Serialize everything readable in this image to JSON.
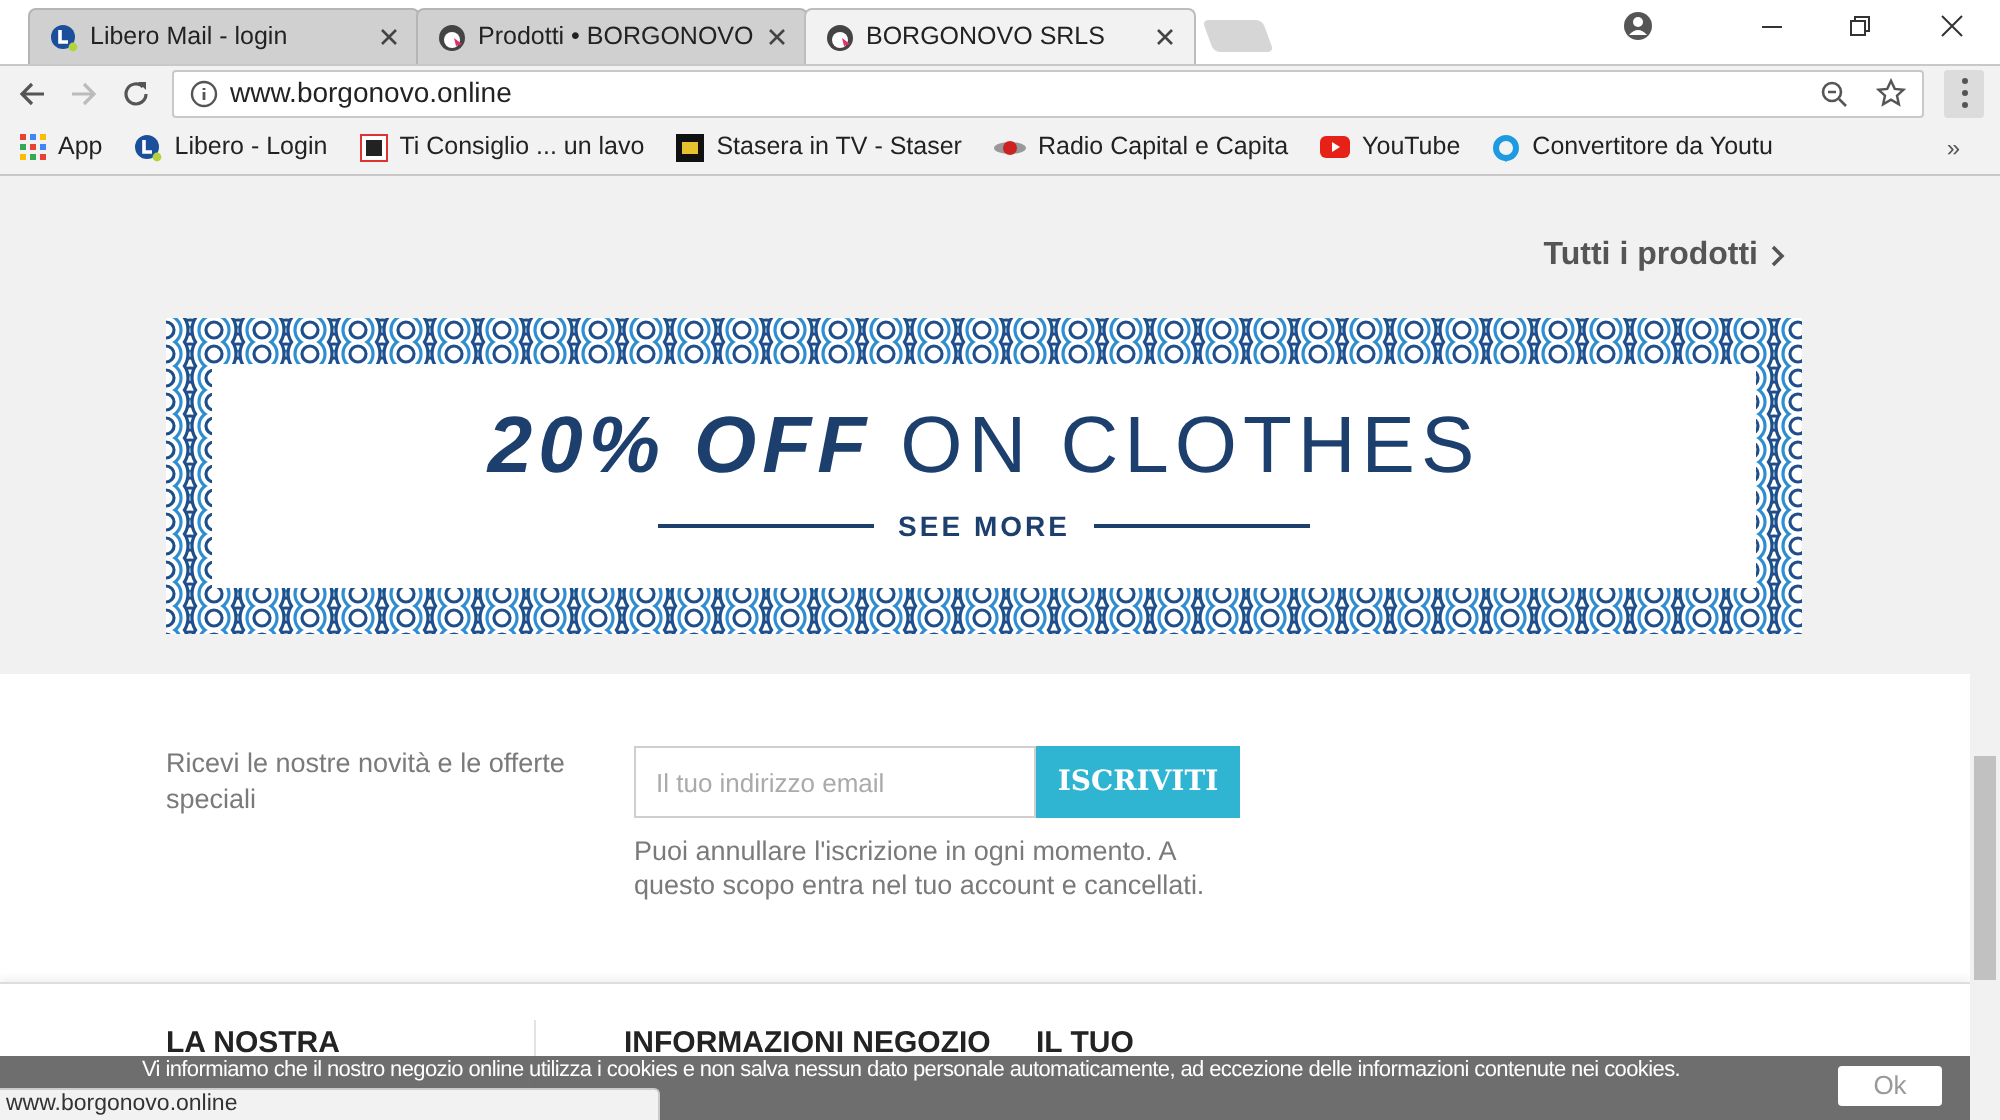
{
  "tabs": [
    {
      "title": "Libero Mail - login",
      "selected": false
    },
    {
      "title": "Prodotti • BORGONOVO",
      "selected": false
    },
    {
      "title": "BORGONOVO SRLS",
      "selected": true
    }
  ],
  "address_bar": {
    "url": "www.borgonovo.online"
  },
  "bookmarks": [
    {
      "label": "App"
    },
    {
      "label": "Libero - Login"
    },
    {
      "label": "Ti Consiglio ... un lavo"
    },
    {
      "label": "Stasera in TV - Staser"
    },
    {
      "label": "Radio Capital e Capita"
    },
    {
      "label": "YouTube"
    },
    {
      "label": "Convertitore da Youtu"
    }
  ],
  "bookmarks_overflow": "»",
  "all_products_link": "Tutti i prodotti",
  "banner": {
    "bold": "20% OFF",
    "rest": "ON CLOTHES",
    "link": "SEE MORE"
  },
  "newsletter": {
    "text": "Ricevi le nostre novità e le offerte speciali",
    "placeholder": "Il tuo indirizzo email",
    "button": "ISCRIVITI",
    "note": "Puoi annullare l'iscrizione in ogni momento. A questo scopo entra nel tuo account e cancellati."
  },
  "footer_columns": [
    {
      "heading": "LA NOSTRA"
    },
    {
      "heading": "INFORMAZIONI NEGOZIO"
    },
    {
      "heading": "IL TUO"
    }
  ],
  "cookie_bar": {
    "text": "Vi informiamo che il nostro negozio online utilizza i cookies e non salva nessun dato personale automaticamente, ad eccezione delle informazioni contenute nei cookies.",
    "button": "Ok"
  },
  "status_bar": "www.borgonovo.online"
}
